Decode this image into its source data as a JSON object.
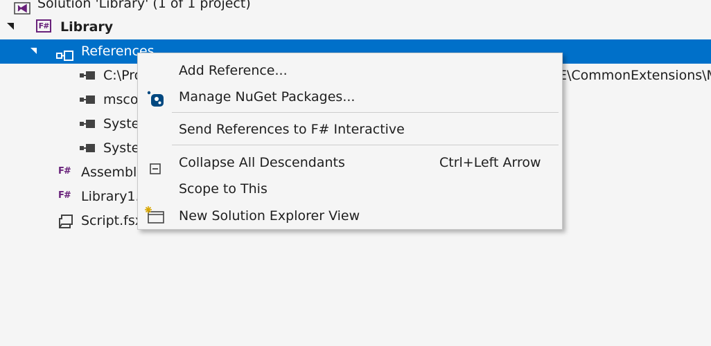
{
  "tree": {
    "solution_label": "Solution 'Library' (1 of 1 project)",
    "project": {
      "label": "Library",
      "icon": "fsharp-project-icon"
    },
    "references": {
      "label": "References",
      "icon": "references-icon"
    },
    "reference_items": [
      {
        "label": "C:\\Pro"
      },
      {
        "label": "msco"
      },
      {
        "label": "Syste"
      },
      {
        "label": "Syste"
      }
    ],
    "truncated_path_tail": "E\\CommonExtensions\\M",
    "files": [
      {
        "label": "Assembly",
        "icon": "fsharp-file-icon"
      },
      {
        "label": "Library1.",
        "icon": "fsharp-file-icon"
      },
      {
        "label": "Script.fsx",
        "icon": "script-file-icon"
      }
    ]
  },
  "context_menu": {
    "items": [
      {
        "label": "Add Reference...",
        "shortcut": ""
      },
      {
        "label": "Manage NuGet Packages...",
        "shortcut": "",
        "icon": "nuget-icon"
      },
      {
        "label": "Send References to F# Interactive",
        "shortcut": ""
      },
      {
        "label": "Collapse All Descendants",
        "shortcut": "Ctrl+Left Arrow",
        "icon": "collapse-icon"
      },
      {
        "label": "Scope to This",
        "shortcut": ""
      },
      {
        "label": "New Solution Explorer View",
        "shortcut": "",
        "icon": "new-view-icon"
      }
    ]
  },
  "colors": {
    "selection": "#0070c9",
    "fsharp_purple": "#68217a",
    "vs_purple": "#68217a",
    "nuget_blue": "#004880"
  }
}
